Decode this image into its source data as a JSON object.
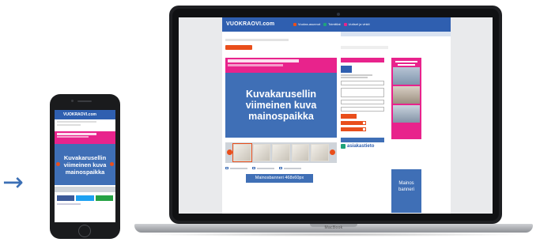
{
  "arrows": {
    "glyph": "→",
    "color": "#3b6fb5"
  },
  "laptop": {
    "brand": "MacBook",
    "site": {
      "logo": "VUOKRAOVI.com",
      "nav": [
        {
          "label": "Vuokra-asunnot",
          "color": "#e94e1b"
        },
        {
          "label": "Toimitilat",
          "color": "#1fa37a"
        },
        {
          "label": "Uutiset ja vinkit",
          "color": "#e8238c"
        }
      ],
      "hero_text": "Kuvakarusellin\nviimeinen kuva\nmainospaikka",
      "banner": "Mainosbanneri 468x60px",
      "ad_blue": "Mainos\nbanneri",
      "sidebar_brand": "asiakastieto"
    }
  },
  "phone": {
    "logo": "VUOKRAOVI.com",
    "hero_text": "Kuvakarusellin\nviimeinen kuva\nmainospaikka",
    "share_colors": [
      "#3b5998",
      "#1da1f2",
      "#25a244"
    ]
  },
  "colors": {
    "brand_blue": "#2f5fb0",
    "pink": "#e8238c",
    "orange": "#e94e1b",
    "hero_blue": "#3f6fb6"
  }
}
